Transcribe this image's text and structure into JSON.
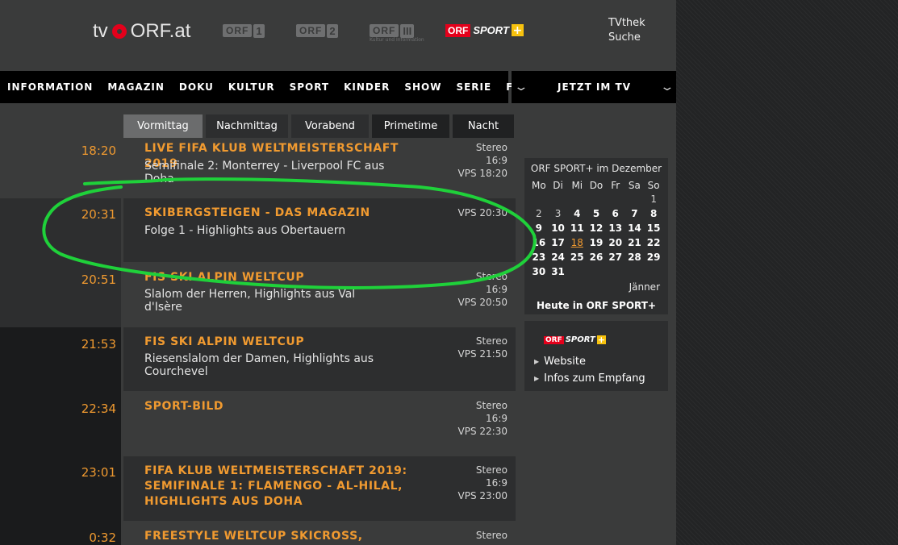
{
  "header": {
    "logo": {
      "left": "tv",
      "right": "ORF.at"
    },
    "channels": [
      {
        "name": "ORF",
        "num": "1"
      },
      {
        "name": "ORF",
        "num": "2"
      },
      {
        "name": "ORF",
        "num": "III",
        "sub": "Kultur und Information"
      }
    ],
    "sport_logo": {
      "orf": "ORF",
      "sport": "SPORT",
      "plus": "+"
    },
    "links": [
      "TVthek",
      "Suche"
    ]
  },
  "nav": {
    "items": [
      "INFORMATION",
      "MAGAZIN",
      "DOKU",
      "KULTUR",
      "SPORT",
      "KINDER",
      "SHOW",
      "SERIE",
      "FILM"
    ],
    "jetzt": "JETZT IM TV"
  },
  "tabs": [
    "Vormittag",
    "Nachmittag",
    "Vorabend",
    "Primetime",
    "Nacht"
  ],
  "schedule": [
    {
      "time": "18:20",
      "title": "LIVE FIFA KLUB WELTMEISTERSCHAFT 2019",
      "subtitle": "Semifinale 2: Monterrey - Liverpool FC aus Doha",
      "meta": [
        "Stereo",
        "16:9",
        "VPS 18:20"
      ]
    },
    {
      "time": "20:31",
      "title": "SKIBERGSTEIGEN - DAS MAGAZIN",
      "subtitle": "Folge 1 - Highlights aus Obertauern",
      "meta": [
        "VPS 20:30"
      ]
    },
    {
      "time": "20:51",
      "title": "FIS SKI ALPIN WELTCUP",
      "subtitle": "Slalom der Herren, Highlights aus Val d'Isère",
      "meta": [
        "Stereo",
        "16:9",
        "VPS 20:50"
      ]
    },
    {
      "time": "21:53",
      "title": "FIS SKI ALPIN WELTCUP",
      "subtitle": "Riesenslalom der Damen, Highlights aus Courchevel",
      "meta": [
        "Stereo",
        "VPS 21:50"
      ]
    },
    {
      "time": "22:34",
      "title": "SPORT-BILD",
      "subtitle": "",
      "meta": [
        "Stereo",
        "16:9",
        "VPS 22:30"
      ]
    },
    {
      "time": "23:01",
      "title": "FIFA KLUB WELTMEISTERSCHAFT 2019: SEMIFINALE 1: FLAMENGO - AL-HILAL, HIGHLIGHTS AUS DOHA",
      "subtitle": "",
      "meta": [
        "Stereo",
        "16:9",
        "VPS 23:00"
      ]
    },
    {
      "time": "0:32",
      "title": "FREESTYLE WELTCUP SKICROSS,",
      "subtitle": "",
      "meta": [
        "Stereo"
      ]
    }
  ],
  "calendar": {
    "title": "ORF SPORT+ im Dezember",
    "weekdays": [
      "Mo",
      "Di",
      "Mi",
      "Do",
      "Fr",
      "Sa",
      "So"
    ],
    "weeks": [
      [
        "",
        "",
        "",
        "",
        "",
        "",
        "1"
      ],
      [
        "2",
        "3",
        "4",
        "5",
        "6",
        "7",
        "8"
      ],
      [
        "9",
        "10",
        "11",
        "12",
        "13",
        "14",
        "15"
      ],
      [
        "16",
        "17",
        "18",
        "19",
        "20",
        "21",
        "22"
      ],
      [
        "23",
        "24",
        "25",
        "26",
        "27",
        "28",
        "29"
      ],
      [
        "30",
        "31",
        "",
        "",
        "",
        "",
        ""
      ]
    ],
    "today": "18",
    "next_month": "Jänner",
    "today_link": "Heute in ORF SPORT+"
  },
  "info_box": {
    "logo": {
      "orf": "ORF",
      "sport": "SPORT",
      "plus": "+"
    },
    "links": [
      "Website",
      "Infos zum Empfang"
    ]
  },
  "colors": {
    "accent": "#f09a30",
    "annotation": "#1fd13a",
    "brand_red": "#e4001b",
    "brand_yellow": "#f7c20e"
  }
}
